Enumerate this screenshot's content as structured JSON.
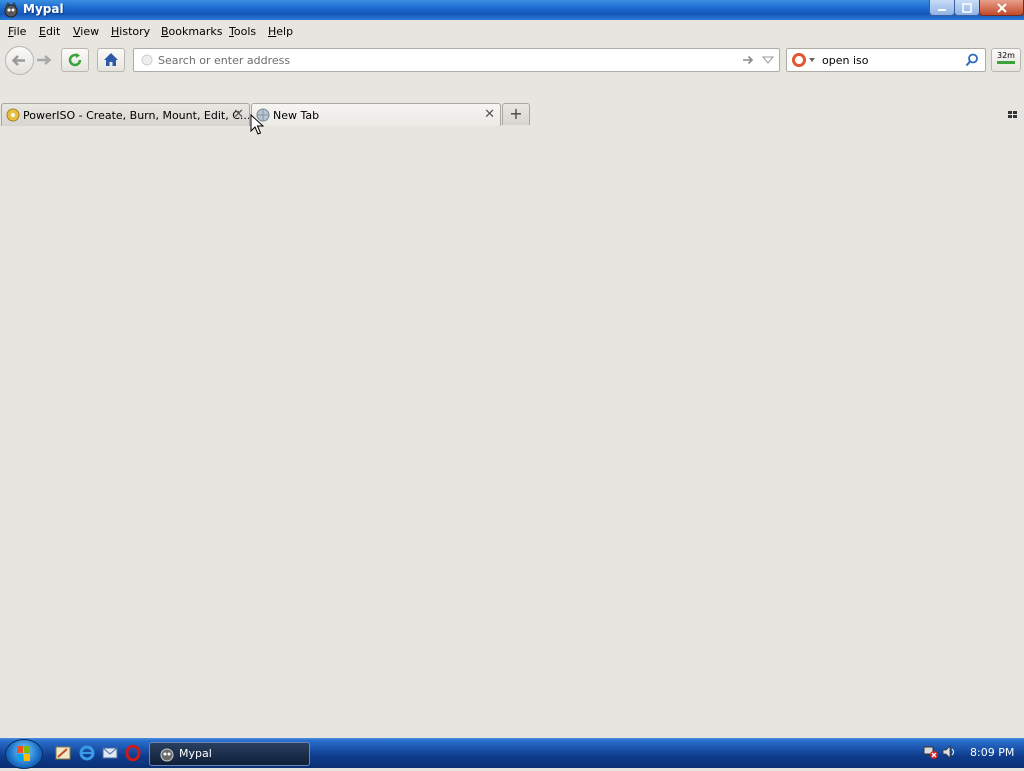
{
  "window": {
    "title": "Mypal",
    "controls": {
      "minimize": "minimize-icon",
      "maximize": "maximize-icon",
      "close": "close-icon"
    }
  },
  "menubar": {
    "items": [
      {
        "label": "File",
        "accel": "F"
      },
      {
        "label": "Edit",
        "accel": "E"
      },
      {
        "label": "View",
        "accel": "V"
      },
      {
        "label": "History",
        "accel": "H"
      },
      {
        "label": "Bookmarks",
        "accel": "B"
      },
      {
        "label": "Tools",
        "accel": "T"
      },
      {
        "label": "Help",
        "accel": "H"
      }
    ]
  },
  "navbar": {
    "address": {
      "placeholder": "Search or enter address",
      "value": ""
    },
    "search": {
      "value": "open iso",
      "engine_icon": "duckduckgo-icon"
    },
    "memory_indicator": "32m"
  },
  "tabs": [
    {
      "label": "PowerISO - Create, Burn, Mount, Edit, C...",
      "selected": false
    },
    {
      "label": "New Tab",
      "selected": true
    }
  ],
  "taskbar": {
    "window_button": "Mypal",
    "clock": "8:09 PM"
  },
  "colors": {
    "titlebar": "#1d6bd0",
    "background": "#e7e5e0",
    "taskbar": "#0e3c8c",
    "reload_green": "#3aa43a",
    "home_blue": "#2a5aa8"
  }
}
